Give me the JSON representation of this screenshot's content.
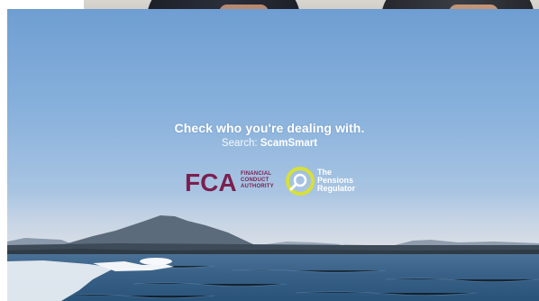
{
  "video": {
    "headline": "Check who you're dealing with.",
    "search_label": "Search:",
    "search_value": "ScamSmart"
  },
  "logos": {
    "fca": {
      "letters": "FCA",
      "line1": "FINANCIAL",
      "line2": "CONDUCT",
      "line3": "AUTHORITY",
      "color": "#7b1f4f"
    },
    "tpr": {
      "line1": "The",
      "line2": "Pensions",
      "line3": "Regulator",
      "ring_color": "#d7e03a"
    }
  },
  "colors": {
    "sky_top": "#6f9ed2",
    "sea": "#2f5c86"
  }
}
